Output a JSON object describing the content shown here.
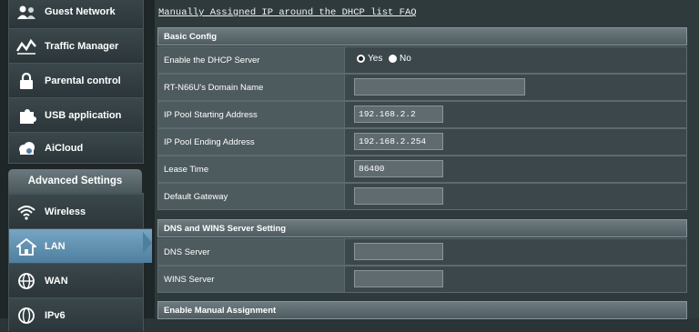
{
  "sidebar": {
    "items": [
      {
        "label": "Guest Network",
        "icon": "guest-network-icon"
      },
      {
        "label": "Traffic Manager",
        "icon": "traffic-manager-icon"
      },
      {
        "label": "Parental control",
        "icon": "parental-control-icon"
      },
      {
        "label": "USB application",
        "icon": "usb-application-icon"
      },
      {
        "label": "AiCloud",
        "icon": "aicloud-icon"
      }
    ],
    "advanced_header": "Advanced Settings",
    "advanced_items": [
      {
        "label": "Wireless",
        "icon": "wireless-icon"
      },
      {
        "label": "LAN",
        "icon": "lan-icon",
        "active": true
      },
      {
        "label": "WAN",
        "icon": "wan-icon"
      },
      {
        "label": "IPv6",
        "icon": "ipv6-icon"
      }
    ]
  },
  "main": {
    "faq_link": "Manually Assigned IP around the DHCP list FAQ",
    "basic_config": {
      "title": "Basic Config",
      "enable_dhcp_label": "Enable the DHCP Server",
      "yes_label": "Yes",
      "no_label": "No",
      "dhcp_enabled": "Yes",
      "domain_label": "RT-N66U's Domain Name",
      "domain_value": "",
      "pool_start_label": "IP Pool Starting Address",
      "pool_start_value": "192.168.2.2",
      "pool_end_label": "IP Pool Ending Address",
      "pool_end_value": "192.168.2.254",
      "lease_label": "Lease Time",
      "lease_value": "86400",
      "gateway_label": "Default Gateway",
      "gateway_value": ""
    },
    "dns_wins": {
      "title": "DNS and WINS Server Setting",
      "dns_label": "DNS Server",
      "dns_value": "",
      "wins_label": "WINS Server",
      "wins_value": ""
    },
    "manual": {
      "title": "Enable Manual Assignment"
    }
  },
  "colors": {
    "active_blue": "#4f7f9f",
    "panel": "#2f3a3d",
    "header": "#5d6b70"
  }
}
